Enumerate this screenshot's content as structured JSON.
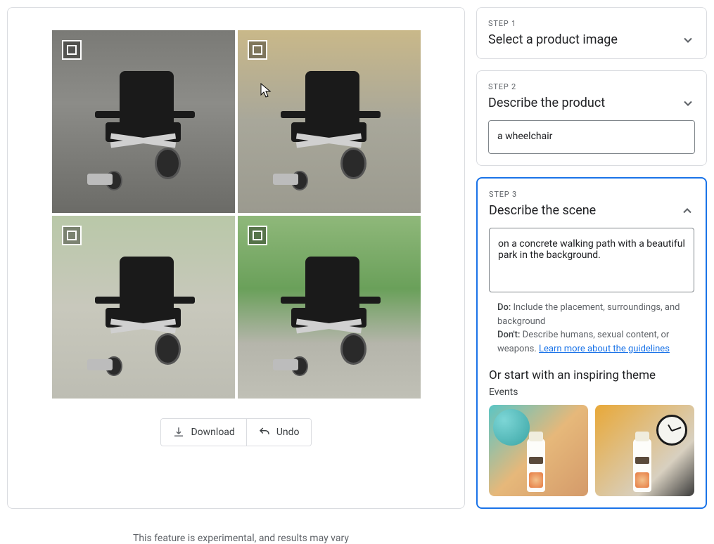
{
  "actions": {
    "download": "Download",
    "undo": "Undo"
  },
  "footer": "This feature is experimental, and results may vary",
  "steps": {
    "step1": {
      "label": "STEP 1",
      "title": "Select a product image"
    },
    "step2": {
      "label": "STEP 2",
      "title": "Describe the product",
      "value": "a wheelchair"
    },
    "step3": {
      "label": "STEP 3",
      "title": "Describe the scene",
      "value": "on a concrete walking path with a beautiful park in the background."
    }
  },
  "guidelines": {
    "do_label": "Do:",
    "do_text": " Include the placement, surroundings, and background",
    "dont_label": "Don't:",
    "dont_text": " Describe humans, sexual content, or weapons. ",
    "link": "Learn more about the guidelines"
  },
  "inspire": {
    "title": "Or start with an inspiring theme",
    "category": "Events"
  }
}
